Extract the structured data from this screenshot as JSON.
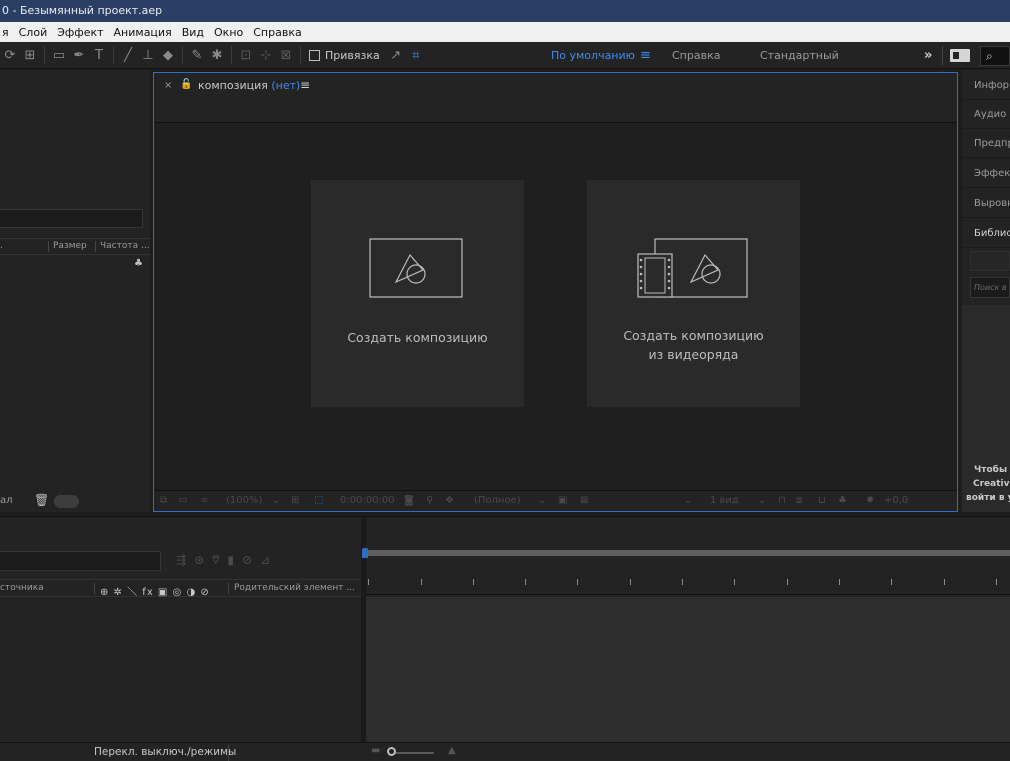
{
  "window": {
    "title": "0 - Безымянный проект.aep"
  },
  "menu": {
    "items": [
      "я",
      "Слой",
      "Эффект",
      "Анимация",
      "Вид",
      "Окно",
      "Справка"
    ]
  },
  "toolbar": {
    "snap_label": "Привязка",
    "icons": [
      "rotate-tool-icon",
      "camera-tool-icon",
      "rectangle-tool-icon",
      "pen-tool-icon",
      "type-tool-icon",
      "brush-tool-icon",
      "clone-stamp-icon",
      "eraser-icon",
      "roto-brush-icon",
      "puppet-pin-icon",
      "local-axis-icon",
      "world-axis-icon",
      "view-axis-icon",
      "snap-checkbox",
      "snap-options-icon",
      "snap-target-icon"
    ]
  },
  "workspaces": {
    "default": "По умолчанию",
    "default_menu": "≡",
    "help": "Справка",
    "standard": "Стандартный",
    "more": "»",
    "search_icon": "⌕"
  },
  "project": {
    "col_size": "Размер",
    "col_rate": "Частота ...",
    "col_left": ".",
    "footer_label": "ал"
  },
  "composition": {
    "close": "×",
    "tab_label": "композиция",
    "tab_none": "(нет)",
    "tab_menu": "≡",
    "new_comp": "Создать композицию",
    "new_comp_footage_line1": "Создать композицию",
    "new_comp_footage_line2": "из видеоряда",
    "zoom": "(100%)",
    "timecode": "0:00:00:00",
    "resolution": "(Полное)",
    "views": "1 вид",
    "exposure": "+0,0"
  },
  "right_panel": {
    "tabs": [
      "Инфор",
      "Аудио",
      "Предпр",
      "Эффек",
      "Выровн",
      "Библис"
    ],
    "search_placeholder": "Поиск в",
    "msg_line1": "Чтобы",
    "msg_line2": "Creative",
    "msg_line3": "войти в у"
  },
  "timeline": {
    "col_source": "сточника",
    "col_parent": "Родительский элемент ...",
    "switch_icons": "⊕ ✲ ＼ fx ▣ ◎ ◑ ⊘",
    "toggle_label": "Перекл. выключ./режимы"
  },
  "colors": {
    "accent": "#2d6fc7",
    "title_bg": "#2a3f63",
    "menu_bg": "#f0f0f0"
  }
}
